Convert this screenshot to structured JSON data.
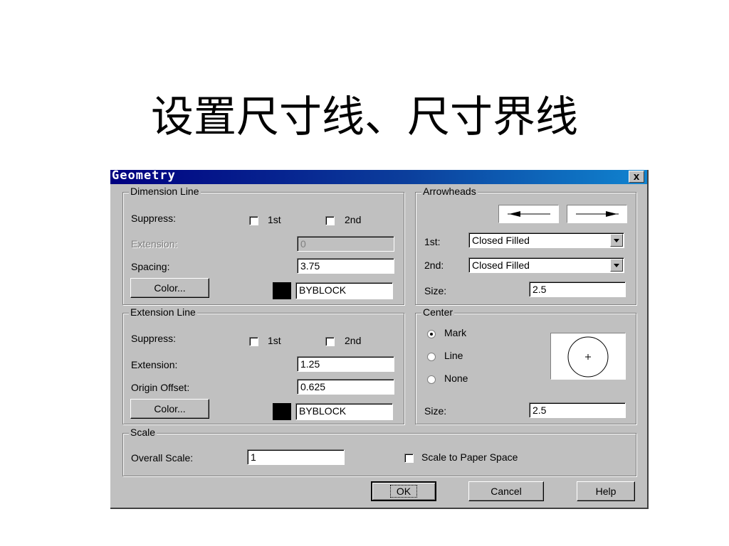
{
  "slide_title": "设置尺寸线、尺寸界线",
  "dialog": {
    "title": "Geometry",
    "close_label": "x",
    "dimension_line": {
      "group_label": "Dimension Line",
      "suppress_label": "Suppress:",
      "chk1_label": "1st",
      "chk2_label": "2nd",
      "extension_label": "Extension:",
      "extension_value": "0",
      "spacing_label": "Spacing:",
      "spacing_value": "3.75",
      "color_button": "Color...",
      "color_value": "BYBLOCK"
    },
    "extension_line": {
      "group_label": "Extension Line",
      "suppress_label": "Suppress:",
      "chk1_label": "1st",
      "chk2_label": "2nd",
      "extension_label": "Extension:",
      "extension_value": "1.25",
      "origin_offset_label": "Origin Offset:",
      "origin_offset_value": "0.625",
      "color_button": "Color...",
      "color_value": "BYBLOCK"
    },
    "arrowheads": {
      "group_label": "Arrowheads",
      "first_label": "1st:",
      "first_value": "Closed Filled",
      "second_label": "2nd:",
      "second_value": "Closed Filled",
      "size_label": "Size:",
      "size_value": "2.5"
    },
    "center": {
      "group_label": "Center",
      "mark_label": "Mark",
      "line_label": "Line",
      "none_label": "None",
      "selected": "Mark",
      "size_label": "Size:",
      "size_value": "2.5"
    },
    "scale": {
      "group_label": "Scale",
      "overall_label": "Overall Scale:",
      "overall_value": "1",
      "paper_space_label": "Scale to Paper Space"
    },
    "buttons": {
      "ok": "OK",
      "cancel": "Cancel",
      "help": "Help"
    }
  },
  "colors": {
    "dialog_face": "#c0c0c0",
    "titlebar_start": "#000080",
    "titlebar_end": "#1084d0",
    "swatch": "#000000"
  }
}
